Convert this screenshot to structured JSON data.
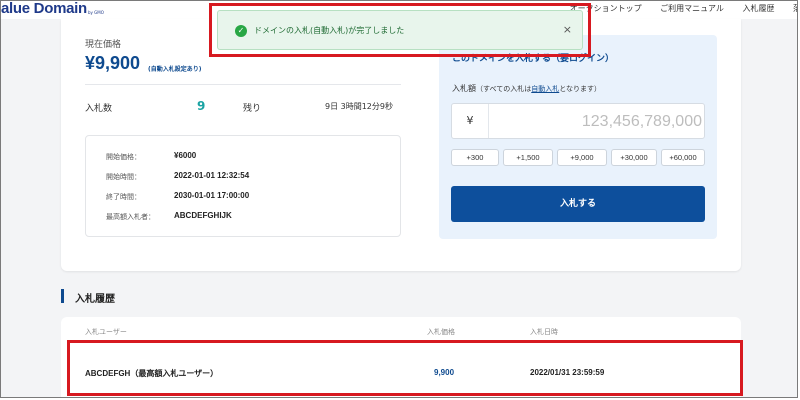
{
  "header": {
    "logo": "alue Domain",
    "logo_sub": "by GMO",
    "nav": [
      "オークショントップ",
      "ご利用マニュアル",
      "入札履歴",
      "落"
    ]
  },
  "toast": {
    "message": "ドメインの入札(自動入札)が完了しました",
    "close": "×",
    "icon": "check-circle-icon"
  },
  "auction": {
    "current_price_label": "現在価格",
    "current_price": "¥9,900",
    "auto_bid_note": "(自動入札設定あり)",
    "bid_count_label": "入札数",
    "bid_count": "9",
    "remaining_label": "残り",
    "remaining": "9日 3時間12分9秒",
    "details": [
      {
        "label": "開始価格：",
        "value": "¥6000"
      },
      {
        "label": "開始時間：",
        "value": "2022-01-01 12:32:54"
      },
      {
        "label": "終了時間：",
        "value": "2030-01-01 17:00:00"
      },
      {
        "label": "最高額入札者：",
        "value": "ABCDEFGHIJK"
      }
    ]
  },
  "bid_panel": {
    "title": "このドメインを入札する（要ログイン）",
    "amount_label": "入札額",
    "amount_note_prefix": "（すべての入札は",
    "amount_note_link": "自動入札",
    "amount_note_suffix": "となります）",
    "currency": "¥",
    "placeholder": "123,456,789,000",
    "quick_amounts": [
      "+300",
      "+1,500",
      "+9,000",
      "+30,000",
      "+60,000"
    ],
    "submit": "入札する"
  },
  "history": {
    "title": "入札履歴",
    "columns": [
      "入札ユーザー",
      "入札価格",
      "入札日時"
    ],
    "rows": [
      {
        "user": "ABCDEFGH（最高額入札ユーザー）",
        "price": "9,900",
        "date": "2022/01/31 23:59:59"
      }
    ]
  },
  "colors": {
    "brand": "#0e4a8f",
    "button": "#0d4f9c",
    "bid_count": "#1aa3a3",
    "highlight": "#d71920",
    "toast_bg": "#e8f5ec"
  }
}
